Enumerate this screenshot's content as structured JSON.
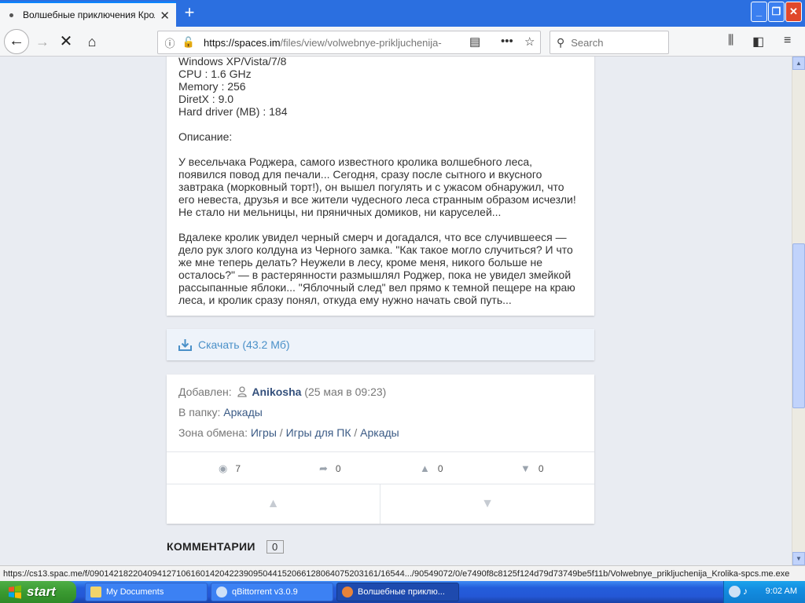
{
  "browser": {
    "tab_title": "Волшебные приключения Кролика",
    "url_host": "https://spaces.im",
    "url_path": "/files/view/volwebnye-prikljuchenija-",
    "search_placeholder": "Search",
    "status_url": "https://cs13.spac.me/f/090142182204094127106160142042239095044152066128064075203161/16544.../90549072/0/e7490f8c8125f124d79d73749be5f11b/Volwebnye_prikljuchenija_Krolika-spcs.me.exe"
  },
  "description": {
    "specs": [
      "Windows XP/Vista/7/8",
      "CPU : 1.6 GHz",
      "Memory : 256",
      "DiretX : 9.0",
      "Hard driver (MB) : 184"
    ],
    "heading": "Описание:",
    "para1": "У весельчака Роджера, самого известного кролика волшебного леса, появился повод для печали... Сегодня, сразу после сытного и вкусного завтрака (морковный торт!), он вышел погулять и с ужасом обнаружил, что его невеста, друзья и все жители чудесного леса странным образом исчезли! Не стало ни мельницы, ни пряничных домиков, ни каруселей...",
    "para2": "Вдалеке кролик увидел черный смерч и догадался, что все случившееся — дело рук злого колдуна из Черного замка. \"Как такое могло случиться? И что же мне теперь делать? Неужели в лесу, кроме меня, никого больше не осталось?\" — в растерянности размышлял Роджер, пока не увидел змейкой рассыпанные яблоки... \"Яблочный след\" вел прямо к темной пещере на краю леса, и кролик сразу понял, откуда ему нужно начать свой путь..."
  },
  "download": {
    "label": "Скачать (43.2 Мб)"
  },
  "info": {
    "added_label": "Добавлен:",
    "user": "Anikosha",
    "date": "(25 мая в 09:23)",
    "folder_label": "В папку:",
    "folder": "Аркады",
    "zone_label": "Зона обмена:",
    "zone_1": "Игры",
    "zone_2": "Игры для ПК",
    "zone_3": "Аркады",
    "sep": "/",
    "views": "7",
    "shares": "0",
    "likes": "0",
    "dislikes": "0"
  },
  "comments": {
    "heading": "КОММЕНТАРИИ",
    "count": "0"
  },
  "taskbar": {
    "start": "start",
    "tasks": [
      "My Documents",
      "qBittorrent v3.0.9",
      "Волшебные приклю..."
    ],
    "clock": "9:02 AM"
  }
}
